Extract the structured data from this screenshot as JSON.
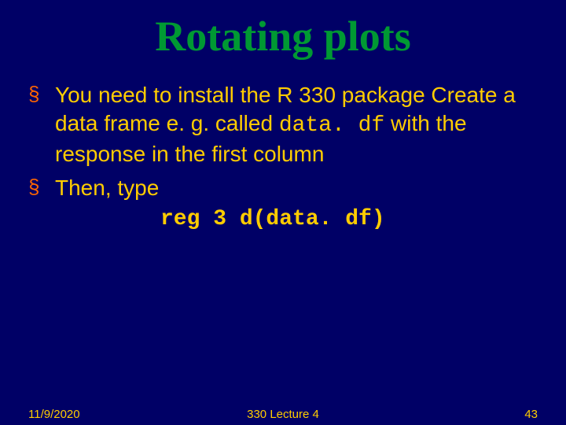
{
  "title": "Rotating plots",
  "bullets": [
    {
      "pre1": "You need to install the R 330 package Create a data frame e. g. called ",
      "code": "data. df",
      "post": " with the response in the first column"
    },
    {
      "pre1": "Then, type"
    }
  ],
  "codeblock": "reg 3 d(data. df)",
  "footer": {
    "date": "11/9/2020",
    "center": "330 Lecture 4",
    "page": "43"
  }
}
